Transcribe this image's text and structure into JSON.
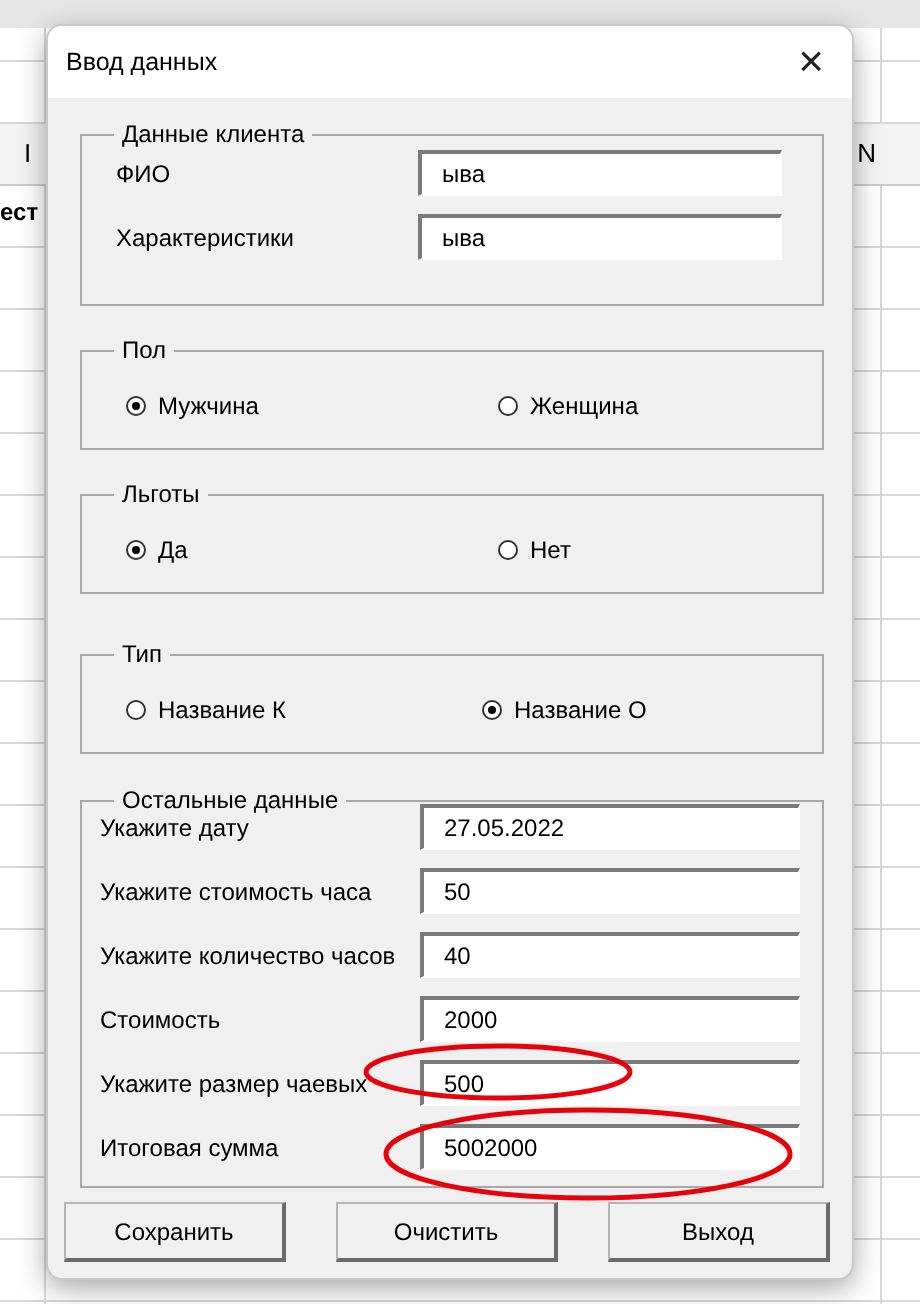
{
  "background_sheet": {
    "column_headers": [
      "I",
      "N"
    ],
    "cell_text": "ест"
  },
  "window": {
    "title": "Ввод данных",
    "close": "×"
  },
  "client_group": {
    "title": "Данные клиента",
    "fields": [
      {
        "label": "ФИО",
        "value": "ыва"
      },
      {
        "label": "Характеристики",
        "value": "ыва"
      }
    ]
  },
  "radio_groups": [
    {
      "title": "Пол",
      "options": [
        {
          "label": "Мужчина",
          "selected": true
        },
        {
          "label": "Женщина",
          "selected": false
        }
      ]
    },
    {
      "title": "Льготы",
      "options": [
        {
          "label": "Да",
          "selected": true
        },
        {
          "label": "Нет",
          "selected": false
        }
      ]
    },
    {
      "title": "Тип",
      "options": [
        {
          "label": "Название К",
          "selected": false
        },
        {
          "label": "Название О",
          "selected": true
        }
      ]
    }
  ],
  "other_group": {
    "title": "Остальные данные",
    "fields": [
      {
        "label": "Укажите дату",
        "value": "27.05.2022",
        "circled": false
      },
      {
        "label": "Укажите стоимость часа",
        "value": "50",
        "circled": false
      },
      {
        "label": "Укажите количество часов",
        "value": "40",
        "circled": false
      },
      {
        "label": "Стоимость",
        "value": "2000",
        "circled": false
      },
      {
        "label": "Укажите размер чаевых",
        "value": "500",
        "circled": true
      },
      {
        "label": "Итоговая сумма",
        "value": "5002000",
        "circled": true
      }
    ]
  },
  "buttons": [
    "Сохранить",
    "Очистить",
    "Выход"
  ]
}
